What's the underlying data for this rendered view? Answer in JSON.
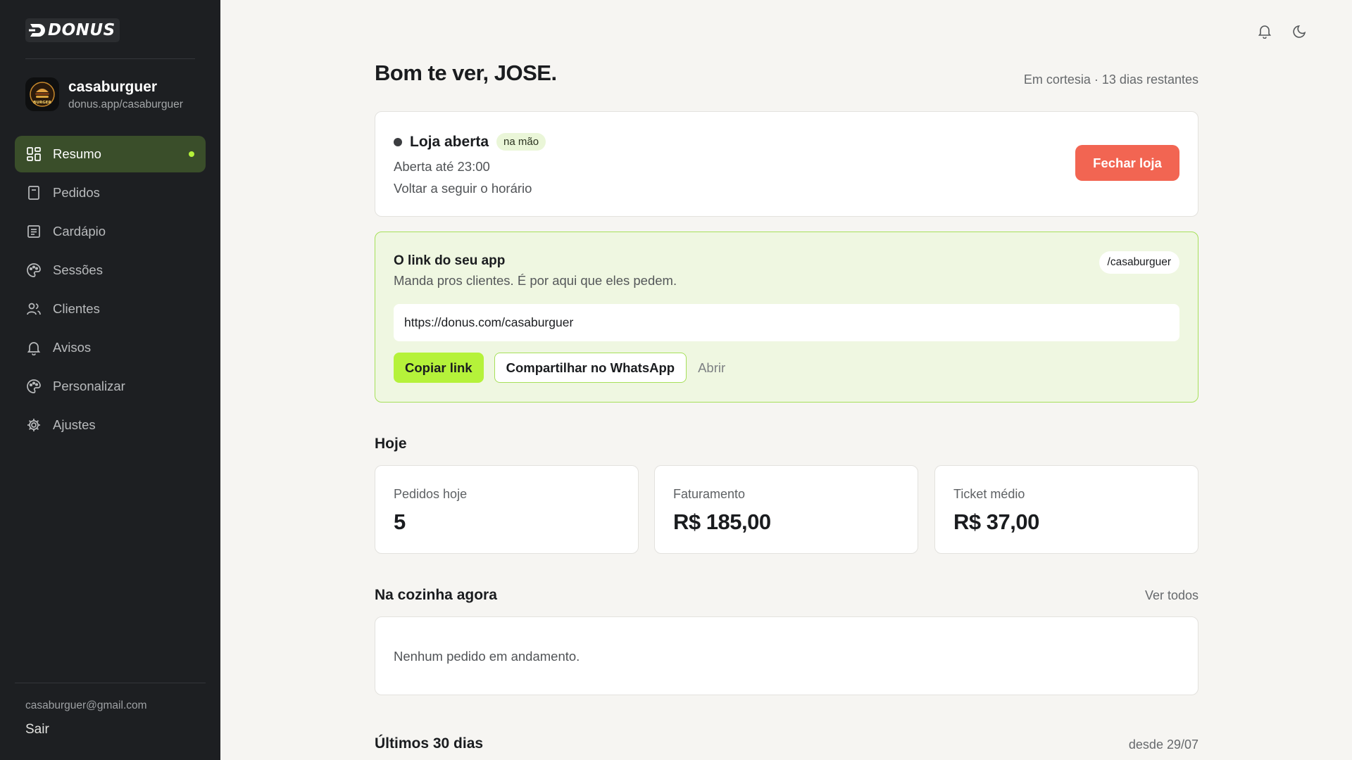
{
  "sidebar": {
    "logo_text": "DONUS",
    "store": {
      "name": "casaburguer",
      "url": "donus.app/casaburguer",
      "avatar_text": "BURGER"
    },
    "items": [
      {
        "label": "Resumo",
        "icon": "dashboard-icon",
        "active": true
      },
      {
        "label": "Pedidos",
        "icon": "receipt-icon"
      },
      {
        "label": "Cardápio",
        "icon": "menu-list-icon"
      },
      {
        "label": "Sessões",
        "icon": "palette-icon"
      },
      {
        "label": "Clientes",
        "icon": "users-icon"
      },
      {
        "label": "Avisos",
        "icon": "bell-icon"
      },
      {
        "label": "Personalizar",
        "icon": "palette-icon"
      },
      {
        "label": "Ajustes",
        "icon": "gear-icon"
      }
    ],
    "email": "casaburguer@gmail.com",
    "logout_label": "Sair"
  },
  "topbar": {
    "icons": [
      "bell-icon",
      "moon-icon"
    ]
  },
  "header": {
    "greeting": "Bom te ver, JOSE.",
    "trial_status": "Em cortesia · 13 dias restantes"
  },
  "store_status": {
    "title": "Loja aberta",
    "badge": "na mão",
    "hours": "Aberta até 23:00",
    "schedule_link": "Voltar a seguir o horário",
    "close_button": "Fechar loja"
  },
  "app_link": {
    "title": "O link do seu app",
    "subtitle": "Manda pros clientes. É por aqui que eles pedem.",
    "slug": "/casaburguer",
    "url": "https://donus.com/casaburguer",
    "copy_button": "Copiar link",
    "share_button": "Compartilhar no WhatsApp",
    "open_link": "Abrir"
  },
  "today": {
    "title": "Hoje",
    "stats": [
      {
        "label": "Pedidos hoje",
        "value": "5"
      },
      {
        "label": "Faturamento",
        "value": "R$ 185,00"
      },
      {
        "label": "Ticket médio",
        "value": "R$ 37,00"
      }
    ]
  },
  "kitchen": {
    "title": "Na cozinha agora",
    "view_all": "Ver todos",
    "empty_message": "Nenhum pedido em andamento."
  },
  "last_30_days": {
    "title": "Últimos 30 dias",
    "since": "desde 29/07"
  },
  "colors": {
    "sidebar_bg": "#1d1f22",
    "accent_green": "#b5f23a",
    "active_nav_bg": "#3a4e2a",
    "danger": "#f26552",
    "link_card_bg": "#eff7e1"
  }
}
